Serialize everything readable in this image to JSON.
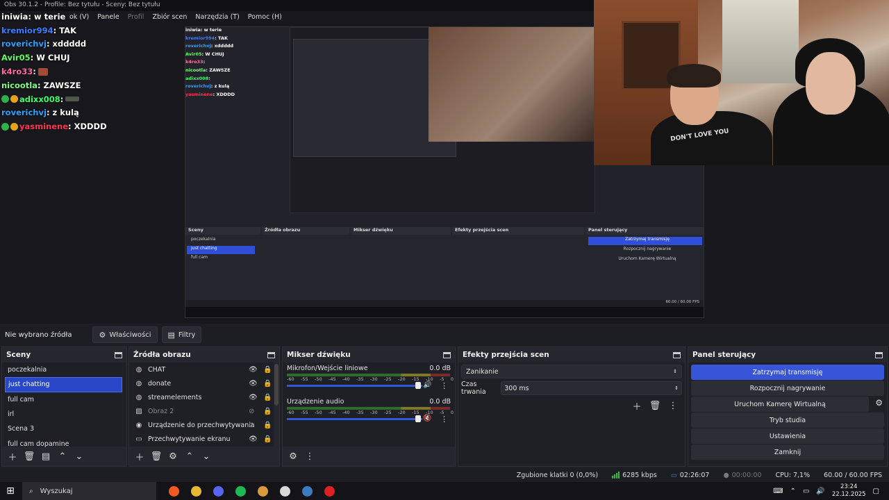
{
  "preview": {
    "window_title": "Obs 30.1.2 - Profile: Bez tytułu - Sceny: Bez tytułu",
    "menu": [
      {
        "label": "Panele",
        "enabled": true
      },
      {
        "label": "Profil",
        "enabled": false
      },
      {
        "label": "Zbiór scen",
        "enabled": true
      },
      {
        "label": "Narzędzia (T)",
        "enabled": true
      },
      {
        "label": "Pomoc (H)",
        "enabled": true
      }
    ],
    "menu_partial": "ok (V)",
    "chat": [
      {
        "user": "iniwia",
        "message": ": w terie",
        "user_color": "#ffffff"
      },
      {
        "user": "kremior994",
        "message": ": TAK",
        "user_color": "#3c7cff"
      },
      {
        "user": "roverichvj",
        "message": ": xddddd",
        "user_color": "#2fa0ff"
      },
      {
        "user": "Avir05",
        "message": ": W CHUJ",
        "user_color": "#5cff5c"
      },
      {
        "user": "k4ro33",
        "message": ":",
        "user_color": "#ff6a9f",
        "emote": true
      },
      {
        "user": "nicootla",
        "message": ": ZAWSZE",
        "user_color": "#7dff7d"
      },
      {
        "user": "adixx008",
        "message": ":",
        "user_color": "#3cff6a",
        "emote": true,
        "badges": 2
      },
      {
        "user": "roverichvj",
        "message": ": z kulą",
        "user_color": "#2fa0ff"
      },
      {
        "user": "yasminene",
        "message": ": XDDDD",
        "user_color": "#ff3355",
        "badges": 2
      }
    ],
    "shirt_text": "DON'T LOVE YOU"
  },
  "toolbar": {
    "no_source": "Nie wybrano źródła",
    "properties": "Właściwości",
    "filters": "Filtry"
  },
  "scenes": {
    "title": "Sceny",
    "items": [
      "poczekalnia",
      "just chatting",
      "full cam",
      "irl",
      "Scena 3",
      "full cam dopamine"
    ],
    "selected_index": 1
  },
  "sources": {
    "title": "Źródła obrazu",
    "items": [
      {
        "name": "CHAT",
        "icon": "browser-icon",
        "visible": true,
        "enabled": true
      },
      {
        "name": "donate",
        "icon": "browser-icon",
        "visible": true,
        "enabled": true
      },
      {
        "name": "streamelements",
        "icon": "browser-icon",
        "visible": true,
        "enabled": true
      },
      {
        "name": "Obraz 2",
        "icon": "image-icon",
        "visible": false,
        "enabled": false
      },
      {
        "name": "Urządzenie do przechwytywania wideo",
        "icon": "camera-icon",
        "visible": false,
        "enabled": true
      },
      {
        "name": "Przechwytywanie ekranu",
        "icon": "monitor-icon",
        "visible": true,
        "enabled": true
      }
    ]
  },
  "mixer": {
    "title": "Mikser dźwięku",
    "ticks": [
      "-60",
      "-55",
      "-50",
      "-45",
      "-40",
      "-35",
      "-30",
      "-25",
      "-20",
      "-15",
      "-10",
      "-5",
      "0"
    ],
    "channels": [
      {
        "name": "Mikrofon/Wejście liniowe",
        "level": "0.0 dB",
        "muted": false,
        "fader": 1.0
      },
      {
        "name": "Urządzenie audio",
        "level": "0.0 dB",
        "muted": true,
        "fader": 1.0
      }
    ]
  },
  "transitions": {
    "title": "Efekty przejścia scen",
    "selected": "Zanikanie",
    "duration_label": "Czas trwania",
    "duration_value": "300 ms"
  },
  "controls": {
    "title": "Panel sterujący",
    "buttons": [
      {
        "label": "Zatrzymaj transmisję",
        "primary": true
      },
      {
        "label": "Rozpocznij nagrywanie",
        "primary": false
      },
      {
        "label": "Uruchom Kamerę Wirtualną",
        "primary": false
      },
      {
        "label": "Tryb studia",
        "primary": false
      },
      {
        "label": "Ustawienia",
        "primary": false
      },
      {
        "label": "Zamknij",
        "primary": false
      }
    ]
  },
  "status": {
    "dropped_frames": "Zgubione klatki 0 (0,0%)",
    "bitrate": "6285 kbps",
    "stream_time": "02:26:07",
    "record_time": "00:00:00",
    "cpu": "CPU: 7,1%",
    "fps": "60.00 / 60.00 FPS"
  },
  "taskbar": {
    "search_placeholder": "Wyszukaj",
    "time": "23:24",
    "date": "22.12.2025",
    "apps": [
      {
        "name": "brave-icon",
        "color": "#f25a24"
      },
      {
        "name": "files-icon",
        "color": "#e8b830"
      },
      {
        "name": "discord-icon",
        "color": "#5865f2"
      },
      {
        "name": "spotify-icon",
        "color": "#1db954"
      },
      {
        "name": "folder-icon",
        "color": "#d89a3a"
      },
      {
        "name": "obs-icon",
        "color": "#d8d8d8"
      },
      {
        "name": "steam-icon",
        "color": "#3b7bbf"
      },
      {
        "name": "youtube-icon",
        "color": "#e02020"
      }
    ]
  }
}
